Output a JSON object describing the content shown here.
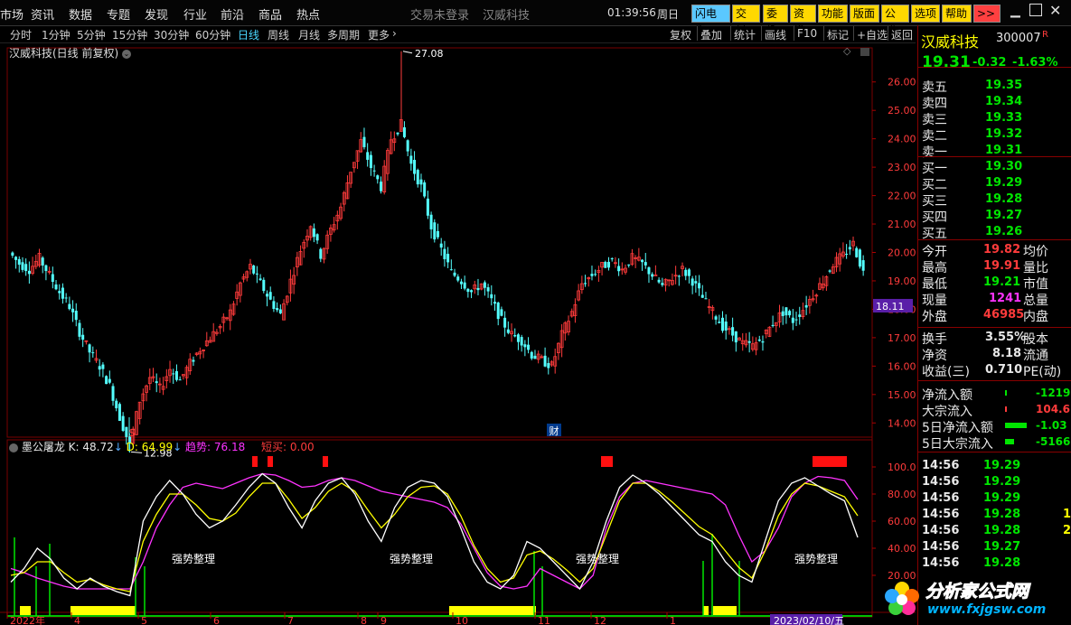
{
  "menu": {
    "items": [
      "市场",
      "资讯",
      "数据",
      "专题",
      "发现",
      "行业",
      "前沿",
      "商品",
      "热点"
    ],
    "status_text": "交易未登录",
    "stock_name": "汉威科技",
    "time": "01:39:56",
    "weekday": "周日",
    "buttons": [
      "闪电手",
      "交易",
      "委托",
      "资讯",
      "功能",
      "版面",
      "公式",
      "选项",
      "帮助",
      ">>"
    ],
    "window_controls": [
      "minimize",
      "restore",
      "close"
    ]
  },
  "periods": {
    "items": [
      "分时",
      "1分钟",
      "5分钟",
      "15分钟",
      "30分钟",
      "60分钟",
      "日线",
      "周线",
      "月线",
      "多周期",
      "更多"
    ],
    "active": "日线"
  },
  "toolbar": [
    "复权",
    "叠加",
    "统计",
    "画线",
    "F10",
    "标记",
    "+自选",
    "返回"
  ],
  "chart": {
    "title": "汉威科技(日线 前复权)",
    "y_axis_labels": [
      "26.00",
      "25.00",
      "24.00",
      "23.00",
      "22.00",
      "21.00",
      "20.00",
      "19.00",
      "18.00",
      "17.00",
      "16.00",
      "15.00",
      "14.00"
    ],
    "current_price_tag": "18.11",
    "high_annotation": "27.08",
    "low_annotation": "12.98",
    "marker_s": "S",
    "marker_cai": "财",
    "up_color": "#ff3b3b",
    "down_color": "#54ffff"
  },
  "indicator": {
    "name": "墨公屠龙",
    "k_label": "K: 48.72",
    "d_label": "D: 64.99",
    "trend_label": "趋势: 76.18",
    "dip_label": "短买: 0.00",
    "y_axis_labels": [
      "100.00",
      "80.00",
      "60.00",
      "40.00",
      "20.00"
    ],
    "zone_labels": [
      "强势整理",
      "强势整理",
      "强势整理",
      "强势整理"
    ]
  },
  "date_axis": {
    "labels": [
      "2022年",
      "4",
      "5",
      "6",
      "7",
      "8",
      "9",
      "10",
      "11",
      "12",
      "1"
    ],
    "cursor_date": "2023/02/10/五"
  },
  "quote": {
    "name": "汉威科技",
    "code": "300007",
    "badge": "R",
    "price": "19.31",
    "change": "-0.32",
    "change_pct": "-1.63%",
    "asks": [
      {
        "label": "卖五",
        "price": "19.35"
      },
      {
        "label": "卖四",
        "price": "19.34"
      },
      {
        "label": "卖三",
        "price": "19.33"
      },
      {
        "label": "卖二",
        "price": "19.32"
      },
      {
        "label": "卖一",
        "price": "19.31"
      }
    ],
    "bids": [
      {
        "label": "买一",
        "price": "19.30"
      },
      {
        "label": "买二",
        "price": "19.29"
      },
      {
        "label": "买三",
        "price": "19.28"
      },
      {
        "label": "买四",
        "price": "19.27"
      },
      {
        "label": "买五",
        "price": "19.26"
      }
    ],
    "stats": [
      {
        "l1": "今开",
        "v1": "19.82",
        "l2": "均价",
        "c": "red"
      },
      {
        "l1": "最高",
        "v1": "19.91",
        "l2": "量比",
        "c": "red"
      },
      {
        "l1": "最低",
        "v1": "19.21",
        "l2": "市值",
        "c": "grn"
      },
      {
        "l1": "现量",
        "v1": "1241",
        "l2": "总量",
        "c": "mag"
      },
      {
        "l1": "外盘",
        "v1": "46985",
        "l2": "内盘",
        "c": "red"
      }
    ],
    "stats2": [
      {
        "l1": "换手",
        "v1": "3.55%",
        "l2": "股本"
      },
      {
        "l1": "净资",
        "v1": "8.18",
        "l2": "流通"
      },
      {
        "l1": "收益(三)",
        "v1": "0.710",
        "l2": "PE(动)"
      }
    ],
    "flows": [
      {
        "label": "净流入额",
        "value": "-1219",
        "c": "grn"
      },
      {
        "label": "大宗流入",
        "value": "104.6",
        "c": "red"
      },
      {
        "label": "5日净流入额",
        "value": "-1.03",
        "c": "grn"
      },
      {
        "label": "5日大宗流入",
        "value": "-5166",
        "c": "grn"
      }
    ],
    "ticks": [
      {
        "time": "14:56",
        "price": "19.29",
        "vol": ""
      },
      {
        "time": "14:56",
        "price": "19.29",
        "vol": ""
      },
      {
        "time": "14:56",
        "price": "19.29",
        "vol": ""
      },
      {
        "time": "14:56",
        "price": "19.28",
        "vol": "1"
      },
      {
        "time": "14:56",
        "price": "19.28",
        "vol": "2"
      },
      {
        "time": "14:56",
        "price": "19.27",
        "vol": ""
      },
      {
        "time": "14:56",
        "price": "19.28",
        "vol": ""
      }
    ]
  },
  "watermark": {
    "text": "分析家公式网",
    "url": "www.fxjgsw.com"
  },
  "chart_data": {
    "type": "candlestick",
    "price_axis_range": [
      13.5,
      26.5
    ],
    "indicator_axis_range": [
      0,
      100
    ],
    "close_path": [
      20.0,
      19.6,
      19.4,
      19.8,
      19.2,
      18.6,
      18.1,
      17.2,
      16.5,
      16.0,
      15.3,
      14.2,
      13.2,
      14.8,
      15.6,
      15.2,
      15.9,
      15.5,
      16.1,
      16.6,
      17.0,
      17.4,
      17.9,
      18.9,
      19.5,
      18.9,
      18.3,
      17.8,
      19.0,
      20.1,
      21.0,
      19.9,
      20.8,
      21.6,
      22.9,
      23.9,
      23.0,
      22.3,
      24.0,
      24.5,
      23.1,
      22.3,
      20.9,
      20.1,
      19.3,
      19.0,
      18.6,
      18.9,
      18.3,
      17.6,
      17.1,
      16.9,
      16.4,
      16.2,
      16.0,
      17.1,
      17.9,
      18.9,
      19.2,
      19.5,
      19.7,
      19.4,
      19.8,
      19.6,
      19.2,
      18.8,
      19.1,
      19.4,
      19.0,
      18.4,
      17.9,
      17.4,
      17.1,
      16.8,
      16.7,
      17.0,
      17.5,
      17.9,
      17.6,
      18.0,
      18.5,
      19.0,
      19.6,
      19.9,
      20.3,
      19.3
    ],
    "k_path": [
      15,
      25,
      40,
      32,
      18,
      10,
      18,
      12,
      8,
      5,
      60,
      78,
      90,
      80,
      65,
      55,
      60,
      72,
      85,
      95,
      88,
      70,
      55,
      75,
      88,
      92,
      80,
      60,
      45,
      70,
      85,
      90,
      88,
      78,
      55,
      30,
      15,
      10,
      20,
      45,
      40,
      30,
      20,
      10,
      30,
      60,
      85,
      94,
      88,
      80,
      70,
      60,
      50,
      45,
      30,
      20,
      15,
      45,
      75,
      88,
      92,
      86,
      80,
      75,
      48
    ],
    "d_path": [
      20,
      22,
      30,
      30,
      22,
      15,
      17,
      13,
      10,
      8,
      45,
      65,
      80,
      80,
      72,
      62,
      60,
      66,
      78,
      88,
      88,
      76,
      62,
      70,
      82,
      88,
      82,
      68,
      55,
      65,
      78,
      85,
      86,
      80,
      64,
      42,
      25,
      15,
      18,
      35,
      38,
      32,
      24,
      15,
      25,
      50,
      75,
      88,
      88,
      82,
      74,
      65,
      56,
      50,
      38,
      26,
      18,
      38,
      64,
      80,
      88,
      86,
      82,
      78,
      64
    ],
    "trend_path": [
      25,
      22,
      18,
      15,
      12,
      10,
      10,
      10,
      10,
      10,
      30,
      55,
      72,
      85,
      88,
      86,
      84,
      88,
      92,
      95,
      94,
      90,
      85,
      86,
      90,
      92,
      90,
      86,
      82,
      80,
      78,
      76,
      74,
      70,
      58,
      40,
      22,
      12,
      10,
      12,
      25,
      20,
      15,
      10,
      20,
      55,
      78,
      88,
      90,
      88,
      86,
      84,
      82,
      80,
      72,
      50,
      30,
      38,
      55,
      78,
      88,
      93,
      92,
      90,
      76
    ]
  }
}
